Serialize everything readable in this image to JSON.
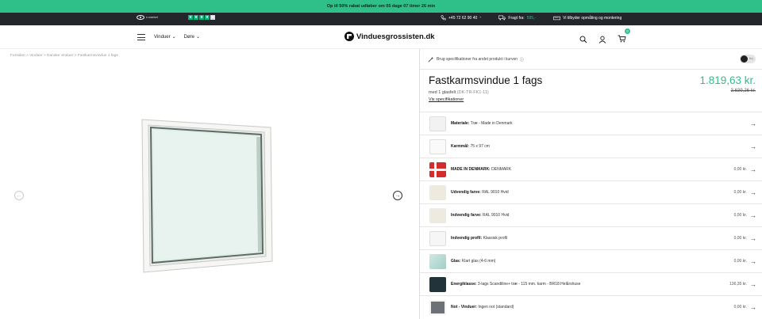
{
  "promo": {
    "text": "Op til 50% rabat udløber om 05 dage 07 timer 26 min"
  },
  "topbar": {
    "emaerke_label": "e-mærket",
    "phone": "+45 72 62 90 40",
    "shipping_label": "Fragt fra:",
    "shipping_value": "595,-",
    "measure_text": "Vi tilbyder opmåling og montering"
  },
  "nav": {
    "links": [
      "Vinduer",
      "Døre"
    ],
    "logo": "Vinduesgrossisten.dk",
    "cart_count": "0"
  },
  "breadcrumb": "Forsiden > Vinduer > Danske vinduer > Fastkarmsvindue 1 fags",
  "spec_bar": {
    "text": "Brug specifikationer fra andet produkt i kurven",
    "toggle_label": "Nej"
  },
  "product": {
    "title": "Fastkarmsvindue 1 fags",
    "price": "1.819,63 kr.",
    "old_price": "3.639,26 kr.",
    "subtitle": "med 1 glasfelt",
    "code": "(DK-TR-FK1-11)",
    "spec_link": "Vis specifikationer"
  },
  "rows": [
    {
      "label": "Materiale:",
      "value": "Træ - Made in Denmark",
      "amount": ""
    },
    {
      "label": "Karmmål:",
      "value": "75 x 97 cm",
      "amount": ""
    },
    {
      "label": "MADE IN DENMARK:",
      "value": "DENMARK",
      "amount": "0,00 kr."
    },
    {
      "label": "Udvendig farve:",
      "value": "RAL 9010 Hvid",
      "amount": "0,00 kr."
    },
    {
      "label": "Indvendig farve:",
      "value": "RAL 9010 Hvid",
      "amount": "0,00 kr."
    },
    {
      "label": "Indvendig profil:",
      "value": "Klassisk profil",
      "amount": "0,00 kr."
    },
    {
      "label": "Glas:",
      "value": "Klart glas (4-6 mm)",
      "amount": "0,00 kr."
    },
    {
      "label": "Energiklasse:",
      "value": "3-lags Scandiline+ træ - 115 mm. karm - BR18 Helårshuse",
      "amount": "136,35 kr."
    },
    {
      "label": "Not - Vinduer:",
      "value": "Ingen not (standard)",
      "amount": "0,00 kr."
    }
  ]
}
